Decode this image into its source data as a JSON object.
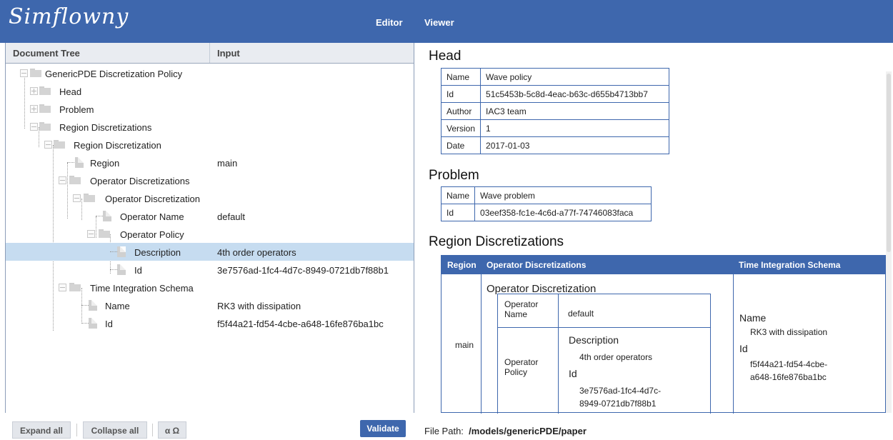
{
  "app": {
    "logo": "Simflowny",
    "nav": [
      "Editor",
      "Viewer"
    ]
  },
  "tree": {
    "col_tree": "Document Tree",
    "col_input": "Input",
    "rows": [
      {
        "label": "GenericPDE Discretization Policy",
        "value": ""
      },
      {
        "label": "Head",
        "value": ""
      },
      {
        "label": "Problem",
        "value": ""
      },
      {
        "label": "Region Discretizations",
        "value": ""
      },
      {
        "label": "Region Discretization",
        "value": ""
      },
      {
        "label": "Region",
        "value": "main"
      },
      {
        "label": "Operator Discretizations",
        "value": ""
      },
      {
        "label": "Operator Discretization",
        "value": ""
      },
      {
        "label": "Operator Name",
        "value": "default"
      },
      {
        "label": "Operator Policy",
        "value": ""
      },
      {
        "label": "Description",
        "value": "4th order operators"
      },
      {
        "label": "Id",
        "value": "3e7576ad-1fc4-4d7c-8949-0721db7f88b1"
      },
      {
        "label": "Time Integration Schema",
        "value": ""
      },
      {
        "label": "Name",
        "value": "RK3 with dissipation"
      },
      {
        "label": "Id",
        "value": "f5f44a21-fd54-4cbe-a648-16fe876ba1bc"
      }
    ]
  },
  "buttons": {
    "expand": "Expand all",
    "collapse": "Collapse all",
    "symbols": "α Ω",
    "validate": "Validate"
  },
  "filepath": {
    "label": "File Path:",
    "value": "/models/genericPDE/paper"
  },
  "viewer": {
    "head_title": "Head",
    "head": [
      {
        "k": "Name",
        "v": "Wave policy"
      },
      {
        "k": "Id",
        "v": "51c5453b-5c8d-4eac-b63c-d655b4713bb7"
      },
      {
        "k": "Author",
        "v": "IAC3 team"
      },
      {
        "k": "Version",
        "v": "1"
      },
      {
        "k": "Date",
        "v": "2017-01-03"
      }
    ],
    "problem_title": "Problem",
    "problem": [
      {
        "k": "Name",
        "v": "Wave problem"
      },
      {
        "k": "Id",
        "v": "03eef358-fc1e-4c6d-a77f-74746083faca"
      }
    ],
    "rd_title": "Region Discretizations",
    "rd_head": {
      "region": "Region",
      "ops": "Operator Discretizations",
      "tis": "Time Integration Schema"
    },
    "rd": {
      "region": "main",
      "op_title": "Operator Discretization",
      "op_name_label": "Operator Name",
      "op_name_value": "default",
      "op_policy_label": "Operator Policy",
      "desc_label": "Description",
      "desc_value": "4th order operators",
      "id_label": "Id",
      "id_value_1": "3e7576ad-1fc4-4d7c-",
      "id_value_2": "8949-0721db7f88b1",
      "tis_name_label": "Name",
      "tis_name_value": "RK3 with dissipation",
      "tis_id_label": "Id",
      "tis_id_value_1": "f5f44a21-fd54-4cbe-",
      "tis_id_value_2": "a648-16fe876ba1bc"
    }
  }
}
